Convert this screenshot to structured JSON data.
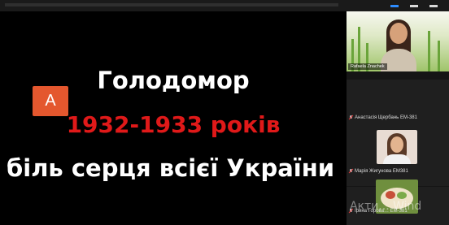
{
  "slide": {
    "line1": "Голодомор",
    "line2": "1932-1933 років",
    "line3": "біль серця всієї України"
  },
  "participants": [
    {
      "name": "Rafaela Znachek",
      "type": "video"
    },
    {
      "name": "Анастасія Щербань ЕМ-381",
      "avatar_letter": "А",
      "avatar_color": "#e4572e",
      "mic": "muted-icon"
    },
    {
      "name": "Марія Жигунова ЕМ381",
      "mic": "muted-icon"
    },
    {
      "name": "Ірина Горова… ЕМ-381",
      "mic": "muted-icon"
    }
  ],
  "watermark": "Акти... Wind",
  "colors": {
    "slide_title": "#ffffff",
    "slide_years": "#e01919",
    "accent": "#2d8cff"
  }
}
